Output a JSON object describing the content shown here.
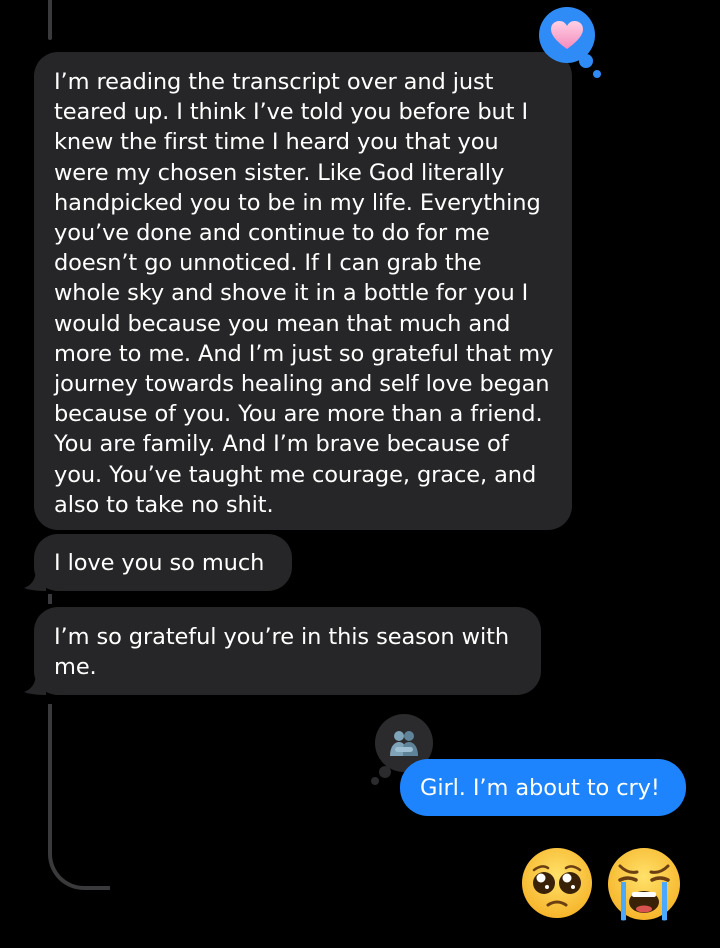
{
  "colors": {
    "background": "#000000",
    "received_bubble": "#262628",
    "sent_bubble": "#1e84fe",
    "tapback_blue": "#2f8cf6",
    "tapback_dark": "#2b2b2d",
    "thread_line": "#3a3a3c"
  },
  "messages": [
    {
      "direction": "received",
      "text": "I’m reading the transcript over and just teared up. I think I’ve told you before but I knew the first time I heard you that you were my chosen sister. Like God literally handpicked you to be in my life. Everything you’ve done and continue to do for me doesn’t go unnoticed. If I can grab the whole sky and shove it in a bottle for you I would because you mean that much and more to me. And I’m just so grateful that my journey towards healing and self love began because of you. You are more than a friend. You are family. And I’m brave because of you. You’ve taught me courage, grace, and also to take no shit.",
      "tapback": "heart-icon"
    },
    {
      "direction": "received",
      "text": "I love you so much"
    },
    {
      "direction": "received",
      "text": "I’m so grateful you’re in this season with me."
    },
    {
      "direction": "sent",
      "text": "Girl. I’m about to cry!",
      "tapback": "hugging-people-icon"
    }
  ],
  "reaction_emojis": [
    "pleading-face-icon",
    "loudly-crying-face-icon"
  ]
}
